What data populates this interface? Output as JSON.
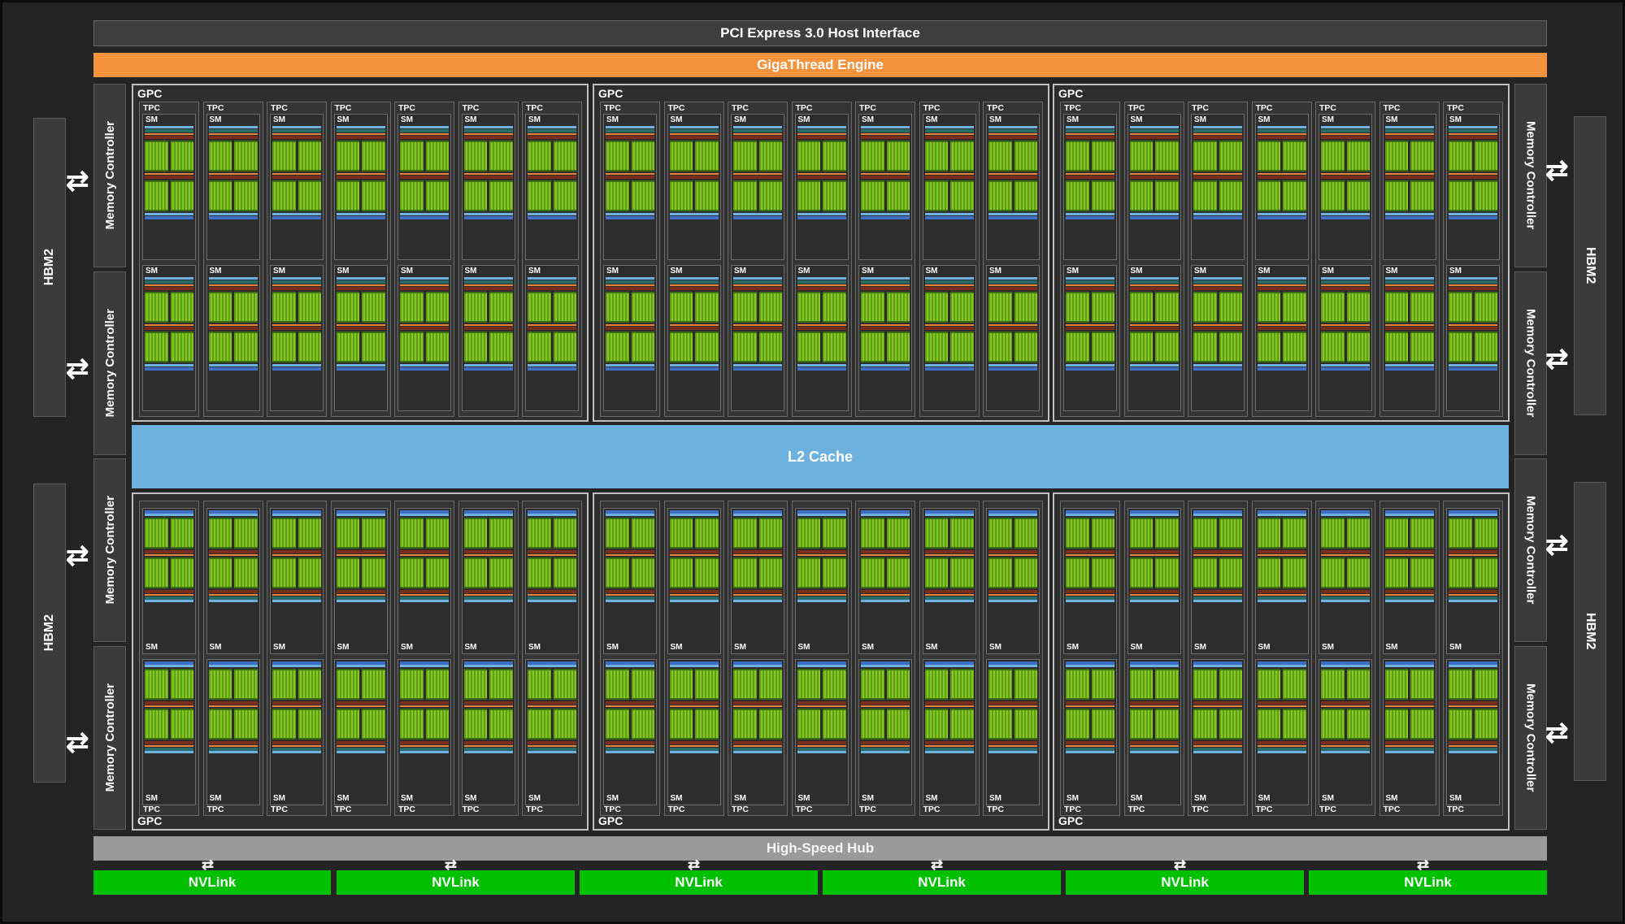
{
  "pcie": {
    "label": "PCI Express 3.0 Host Interface"
  },
  "gigathread": {
    "label": "GigaThread Engine"
  },
  "l2": {
    "label": "L2 Cache"
  },
  "hub": {
    "label": "High-Speed Hub"
  },
  "hbm_label": "HBM2",
  "memory_controller_label": "Memory Controller",
  "gpc_label": "GPC",
  "tpc_label": "TPC",
  "sm_label": "SM",
  "nvlinks": [
    "NVLink",
    "NVLink",
    "NVLink",
    "NVLink",
    "NVLink",
    "NVLink"
  ],
  "colors": {
    "pcie_bar": "#3e3e3e",
    "gigathread": "#f5923e",
    "l2_cache": "#6db1de",
    "hub": "#9a9a9a",
    "nvlink": "#00c000",
    "core_green": "#7ab822"
  },
  "icons": {
    "arrow": "bidirectional-arrow-icon"
  }
}
